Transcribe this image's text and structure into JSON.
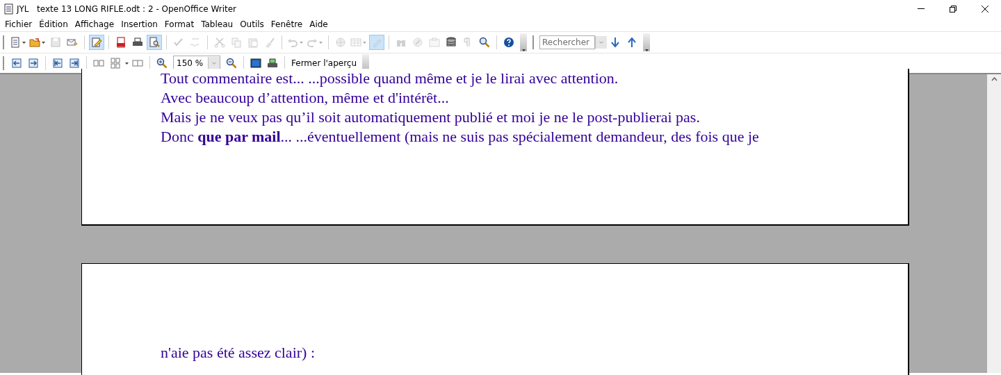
{
  "window": {
    "title": "JYL   texte 13 LONG RIFLE.odt : 2 - OpenOffice Writer"
  },
  "menu": [
    "Fichier",
    "Édition",
    "Affichage",
    "Insertion",
    "Format",
    "Tableau",
    "Outils",
    "Fenêtre",
    "Aide"
  ],
  "toolbar": [
    {
      "kind": "icon",
      "disabled": false,
      "selected": false,
      "menu": true
    },
    {
      "kind": "icon",
      "disabled": false,
      "selected": false,
      "menu": true
    },
    {
      "kind": "icon",
      "disabled": true,
      "selected": false,
      "menu": false
    },
    {
      "kind": "icon",
      "disabled": false,
      "selected": false,
      "menu": false
    },
    {
      "kind": "separator"
    },
    {
      "kind": "icon",
      "disabled": false,
      "selected": true,
      "menu": false
    },
    {
      "kind": "separator"
    },
    {
      "kind": "icon",
      "disabled": false,
      "selected": false,
      "menu": false
    },
    {
      "kind": "icon",
      "disabled": false,
      "selected": false,
      "menu": false
    },
    {
      "kind": "icon",
      "disabled": false,
      "selected": true,
      "menu": false
    },
    {
      "kind": "separator"
    },
    {
      "kind": "icon",
      "disabled": true,
      "selected": false,
      "menu": false
    },
    {
      "kind": "icon",
      "disabled": true,
      "selected": false,
      "menu": false
    },
    {
      "kind": "separator"
    },
    {
      "kind": "icon",
      "disabled": true,
      "selected": false,
      "menu": false
    },
    {
      "kind": "icon",
      "disabled": true,
      "selected": false,
      "menu": false
    },
    {
      "kind": "icon",
      "disabled": true,
      "selected": false,
      "menu": false
    },
    {
      "kind": "icon",
      "disabled": true,
      "selected": false,
      "menu": false
    },
    {
      "kind": "separator"
    },
    {
      "kind": "icon",
      "disabled": true,
      "selected": false,
      "menu": true
    },
    {
      "kind": "icon",
      "disabled": true,
      "selected": false,
      "menu": true
    },
    {
      "kind": "separator"
    },
    {
      "kind": "icon",
      "disabled": true,
      "selected": false,
      "menu": false
    },
    {
      "kind": "icon",
      "disabled": true,
      "selected": false,
      "menu": true
    },
    {
      "kind": "icon",
      "disabled": true,
      "selected": true,
      "menu": false
    },
    {
      "kind": "separator"
    },
    {
      "kind": "icon",
      "disabled": true,
      "selected": false,
      "menu": false
    },
    {
      "kind": "icon",
      "disabled": true,
      "selected": false,
      "menu": false
    },
    {
      "kind": "icon",
      "disabled": true,
      "selected": false,
      "menu": false
    },
    {
      "kind": "icon",
      "disabled": false,
      "selected": false,
      "menu": false
    },
    {
      "kind": "icon",
      "disabled": true,
      "selected": false,
      "menu": false
    },
    {
      "kind": "icon",
      "disabled": false,
      "selected": false,
      "menu": false
    },
    {
      "kind": "separator"
    },
    {
      "kind": "icon",
      "disabled": false,
      "selected": false,
      "menu": false
    }
  ],
  "search": {
    "placeholder": "Rechercher"
  },
  "preview_toolbar": {
    "zoom": "150 %",
    "close_button": "Fermer l'aperçu"
  },
  "pages": [
    {
      "lines": [
        "Tout commentaire est... ...possible quand même et je le lirai avec attention.",
        "Avec beaucoup d’attention, même et d'intérêt...",
        "Mais je ne veux pas qu’il soit automatiquement publié et moi je ne le post-publierai pas.",
        "Donc **que par mail**... ...éventuellement (mais ne suis pas spécialement demandeur, des fois que je"
      ]
    },
    {
      "lines": [
        "n'aie pas été assez clair) :"
      ]
    }
  ]
}
